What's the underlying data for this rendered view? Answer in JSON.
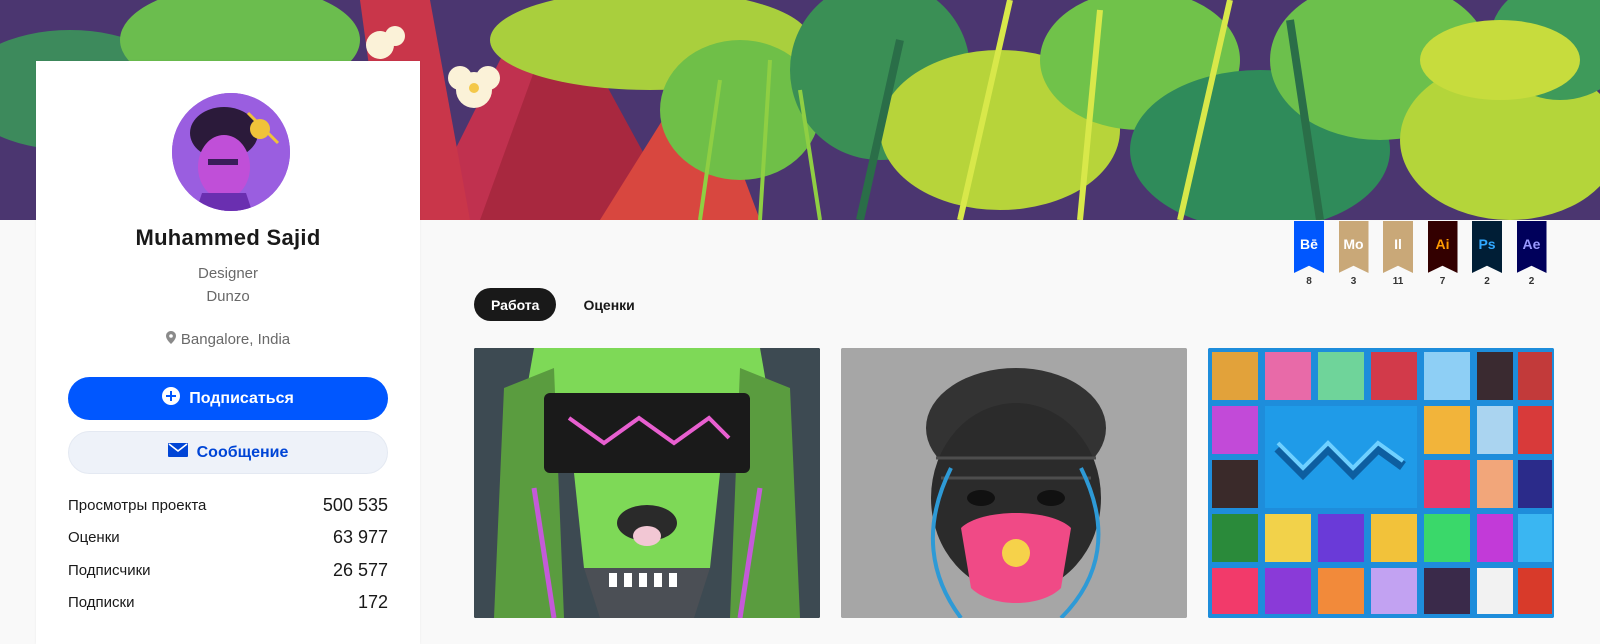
{
  "profile": {
    "name": "Muhammed Sajid",
    "occupation": "Designer",
    "company": "Dunzo",
    "location": "Bangalore, India"
  },
  "actions": {
    "follow_label": "Подписаться",
    "message_label": "Сообщение"
  },
  "stats": [
    {
      "label": "Просмотры проекта",
      "value": "500 535"
    },
    {
      "label": "Оценки",
      "value": "63 977"
    },
    {
      "label": "Подписчики",
      "value": "26 577"
    },
    {
      "label": "Подписки",
      "value": "172"
    }
  ],
  "badges": [
    {
      "abbr": "Bē",
      "count": "8",
      "bg": "#0057ff",
      "fg": "#ffffff"
    },
    {
      "abbr": "Mo",
      "count": "3",
      "bg": "#c9a878",
      "fg": "#ffffff"
    },
    {
      "abbr": "Il",
      "count": "11",
      "bg": "#c9a878",
      "fg": "#ffffff"
    },
    {
      "abbr": "Ai",
      "count": "7",
      "bg": "#330000",
      "fg": "#ff9a00"
    },
    {
      "abbr": "Ps",
      "count": "2",
      "bg": "#001e36",
      "fg": "#31a8ff"
    },
    {
      "abbr": "Ae",
      "count": "2",
      "bg": "#00005b",
      "fg": "#9999ff"
    }
  ],
  "tabs": [
    {
      "label": "Работа",
      "active": true
    },
    {
      "label": "Оценки",
      "active": false
    }
  ],
  "colors": {
    "accent": "#0057ff",
    "message_bg": "#eef2f9",
    "tab_active": "#191919"
  },
  "icons": {
    "follow": "plus-circle-icon",
    "message": "envelope-icon",
    "location": "map-pin-icon"
  }
}
